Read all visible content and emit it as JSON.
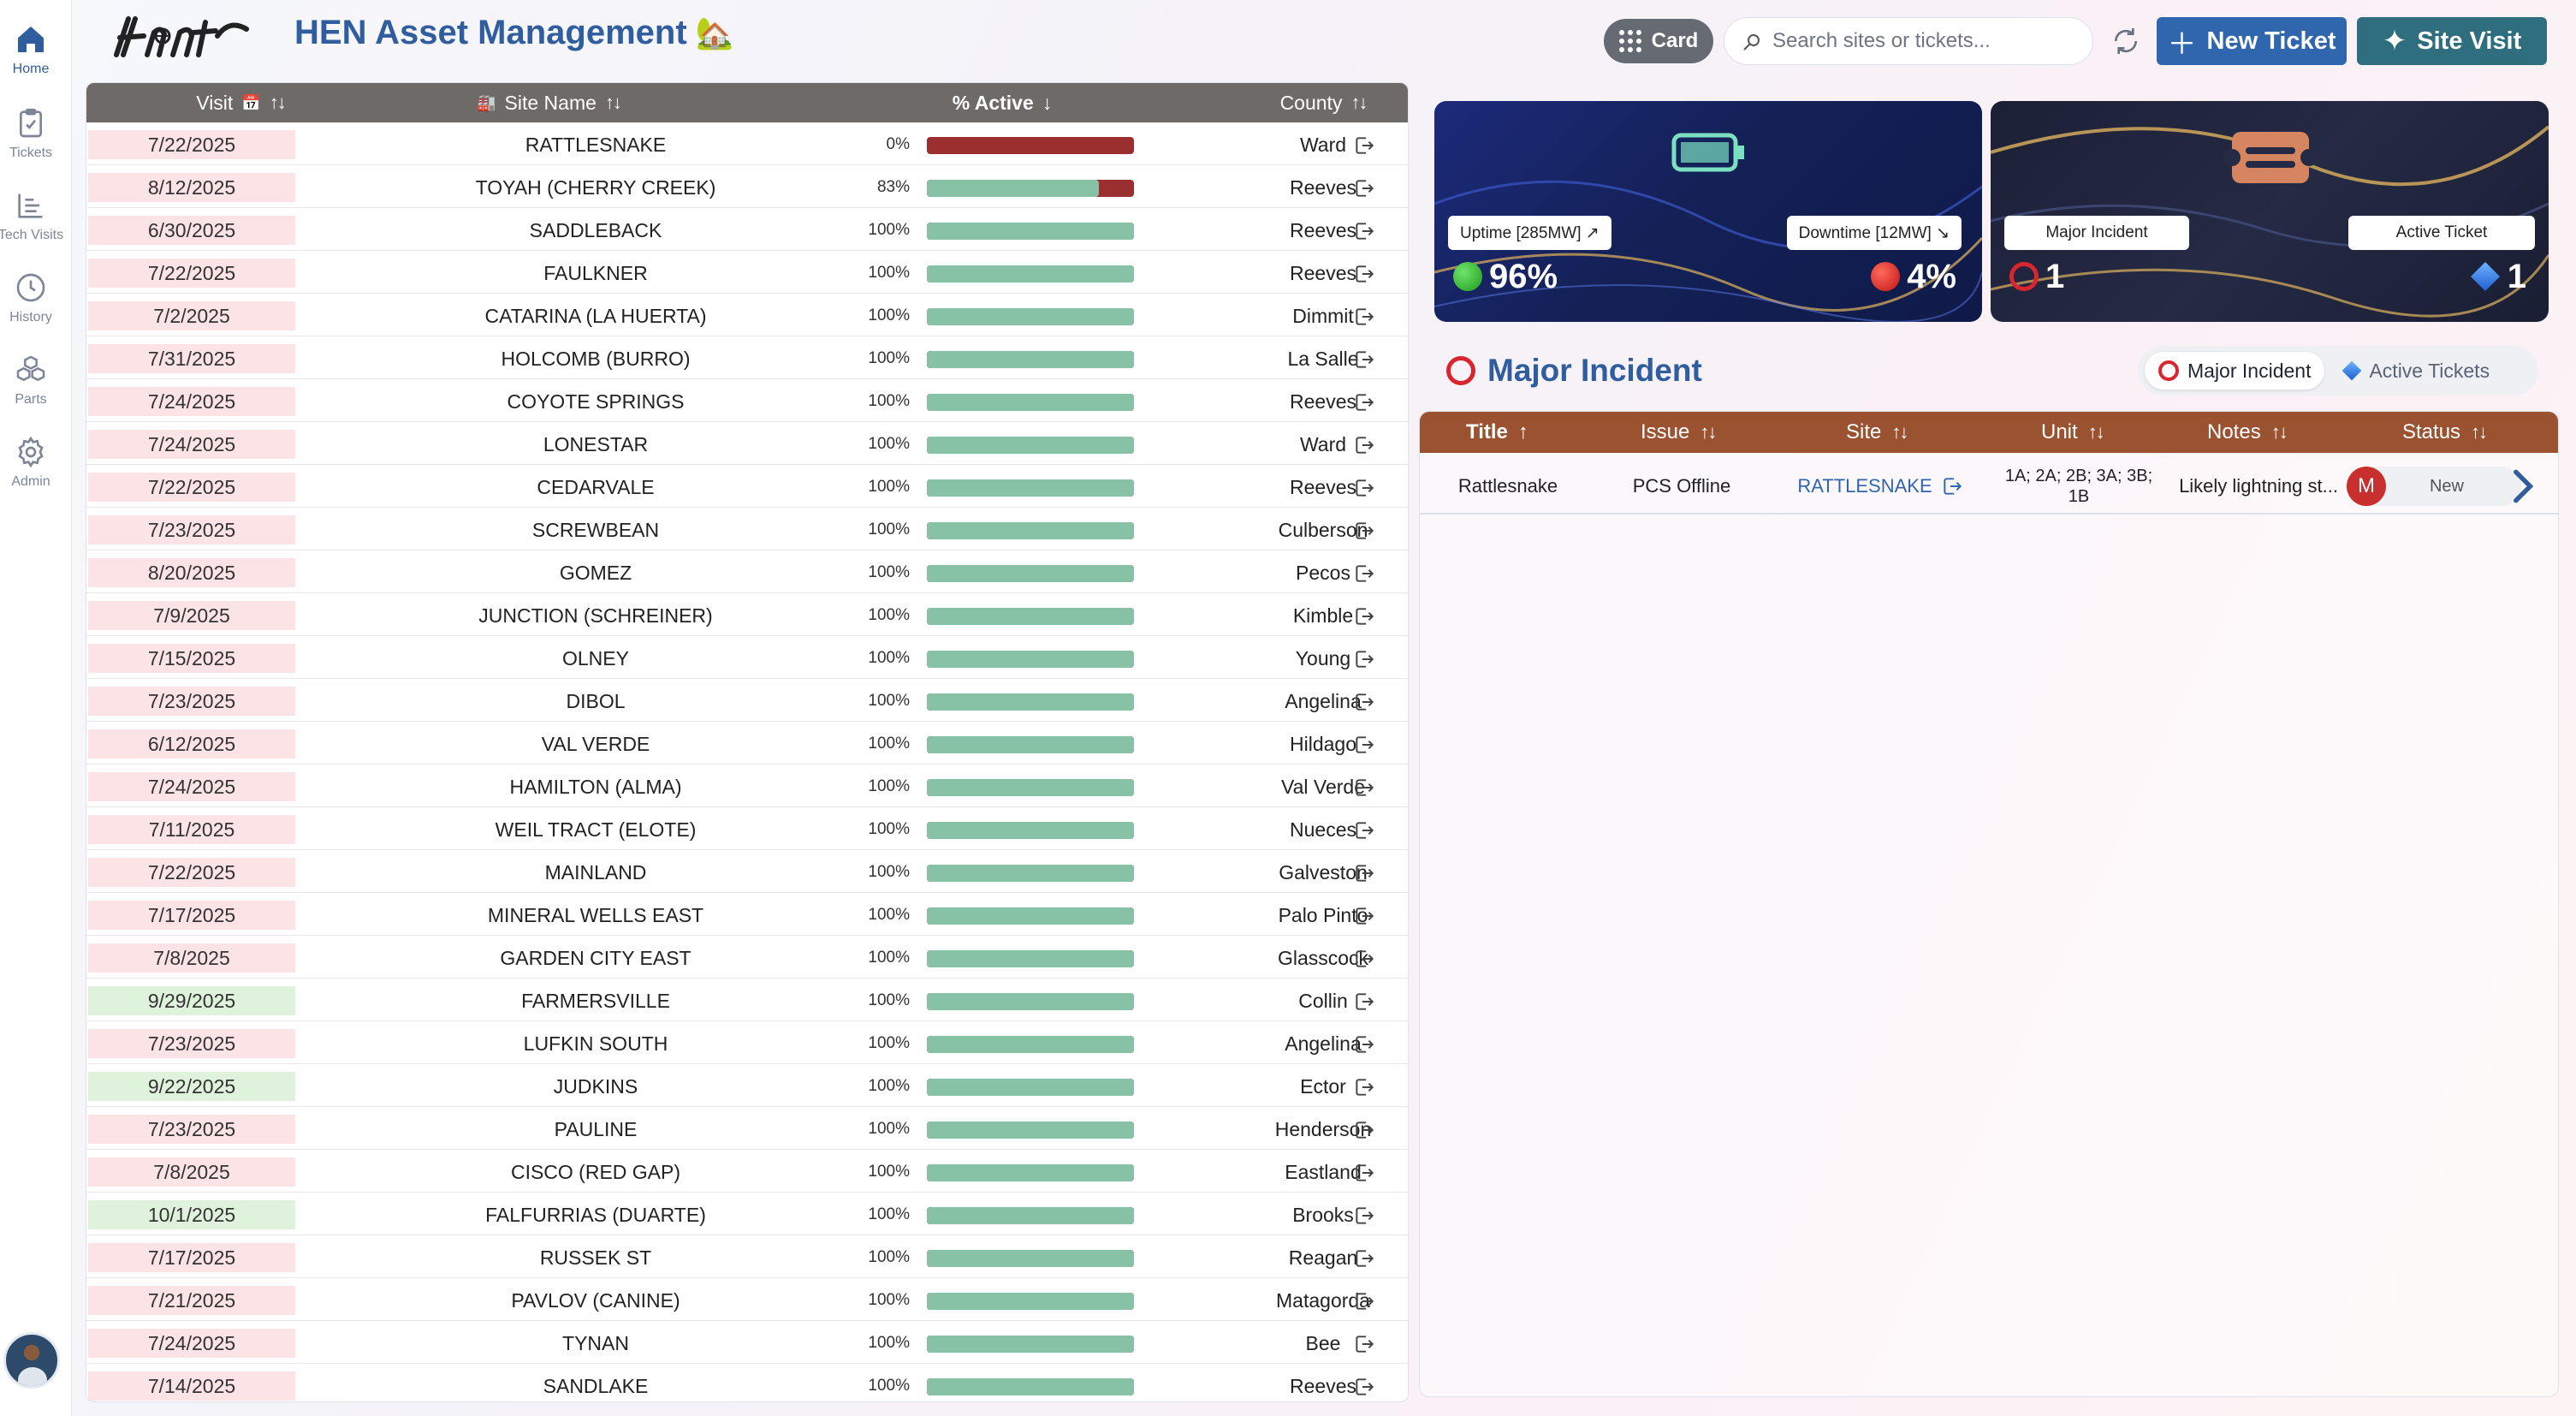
{
  "header": {
    "app_title": "HEN Asset Management",
    "title_emoji": "🏡",
    "view_toggle_label": "Card",
    "search_placeholder": "Search sites or tickets...",
    "new_ticket_label": "New Ticket",
    "site_visit_label": "Site Visit"
  },
  "sidebar": {
    "items": [
      {
        "label": "Home",
        "icon": "home-icon",
        "active": true
      },
      {
        "label": "Tickets",
        "icon": "clipboard-icon",
        "active": false
      },
      {
        "label": "Tech Visits",
        "icon": "list-icon",
        "active": false
      },
      {
        "label": "History",
        "icon": "clock-icon",
        "active": false
      },
      {
        "label": "Parts",
        "icon": "cubes-icon",
        "active": false
      },
      {
        "label": "Admin",
        "icon": "gear-icon",
        "active": false
      }
    ]
  },
  "site_table": {
    "columns": {
      "visit": "Visit",
      "visit_emoji": "📅",
      "site_name": "Site Name",
      "site_emoji": "🏭",
      "active": "% Active",
      "county": "County"
    },
    "rows": [
      {
        "visit": "7/22/2025",
        "visit_status": "red",
        "site": "RATTLESNAKE",
        "pct_label": "0%",
        "pct": 0,
        "county": "Ward"
      },
      {
        "visit": "8/12/2025",
        "visit_status": "red",
        "site": "TOYAH (CHERRY CREEK)",
        "pct_label": "83%",
        "pct": 83,
        "county": "Reeves"
      },
      {
        "visit": "6/30/2025",
        "visit_status": "red",
        "site": "SADDLEBACK",
        "pct_label": "100%",
        "pct": 100,
        "county": "Reeves"
      },
      {
        "visit": "7/22/2025",
        "visit_status": "red",
        "site": "FAULKNER",
        "pct_label": "100%",
        "pct": 100,
        "county": "Reeves"
      },
      {
        "visit": "7/2/2025",
        "visit_status": "red",
        "site": "CATARINA (LA HUERTA)",
        "pct_label": "100%",
        "pct": 100,
        "county": "Dimmit"
      },
      {
        "visit": "7/31/2025",
        "visit_status": "red",
        "site": "HOLCOMB (BURRO)",
        "pct_label": "100%",
        "pct": 100,
        "county": "La Salle"
      },
      {
        "visit": "7/24/2025",
        "visit_status": "red",
        "site": "COYOTE SPRINGS",
        "pct_label": "100%",
        "pct": 100,
        "county": "Reeves"
      },
      {
        "visit": "7/24/2025",
        "visit_status": "red",
        "site": "LONESTAR",
        "pct_label": "100%",
        "pct": 100,
        "county": "Ward"
      },
      {
        "visit": "7/22/2025",
        "visit_status": "red",
        "site": "CEDARVALE",
        "pct_label": "100%",
        "pct": 100,
        "county": "Reeves"
      },
      {
        "visit": "7/23/2025",
        "visit_status": "red",
        "site": "SCREWBEAN",
        "pct_label": "100%",
        "pct": 100,
        "county": "Culberson"
      },
      {
        "visit": "8/20/2025",
        "visit_status": "red",
        "site": "GOMEZ",
        "pct_label": "100%",
        "pct": 100,
        "county": "Pecos"
      },
      {
        "visit": "7/9/2025",
        "visit_status": "red",
        "site": "JUNCTION (SCHREINER)",
        "pct_label": "100%",
        "pct": 100,
        "county": "Kimble"
      },
      {
        "visit": "7/15/2025",
        "visit_status": "red",
        "site": "OLNEY",
        "pct_label": "100%",
        "pct": 100,
        "county": "Young"
      },
      {
        "visit": "7/23/2025",
        "visit_status": "red",
        "site": "DIBOL",
        "pct_label": "100%",
        "pct": 100,
        "county": "Angelina"
      },
      {
        "visit": "6/12/2025",
        "visit_status": "red",
        "site": "VAL VERDE",
        "pct_label": "100%",
        "pct": 100,
        "county": "Hildago"
      },
      {
        "visit": "7/24/2025",
        "visit_status": "red",
        "site": "HAMILTON (ALMA)",
        "pct_label": "100%",
        "pct": 100,
        "county": "Val Verde"
      },
      {
        "visit": "7/11/2025",
        "visit_status": "red",
        "site": "WEIL TRACT (ELOTE)",
        "pct_label": "100%",
        "pct": 100,
        "county": "Nueces"
      },
      {
        "visit": "7/22/2025",
        "visit_status": "red",
        "site": "MAINLAND",
        "pct_label": "100%",
        "pct": 100,
        "county": "Galveston"
      },
      {
        "visit": "7/17/2025",
        "visit_status": "red",
        "site": "MINERAL WELLS EAST",
        "pct_label": "100%",
        "pct": 100,
        "county": "Palo Pinto"
      },
      {
        "visit": "7/8/2025",
        "visit_status": "red",
        "site": "GARDEN CITY EAST",
        "pct_label": "100%",
        "pct": 100,
        "county": "Glasscock"
      },
      {
        "visit": "9/29/2025",
        "visit_status": "green",
        "site": "FARMERSVILLE",
        "pct_label": "100%",
        "pct": 100,
        "county": "Collin"
      },
      {
        "visit": "7/23/2025",
        "visit_status": "red",
        "site": "LUFKIN SOUTH",
        "pct_label": "100%",
        "pct": 100,
        "county": "Angelina"
      },
      {
        "visit": "9/22/2025",
        "visit_status": "green",
        "site": "JUDKINS",
        "pct_label": "100%",
        "pct": 100,
        "county": "Ector"
      },
      {
        "visit": "7/23/2025",
        "visit_status": "red",
        "site": "PAULINE",
        "pct_label": "100%",
        "pct": 100,
        "county": "Henderson"
      },
      {
        "visit": "7/8/2025",
        "visit_status": "red",
        "site": "CISCO (RED GAP)",
        "pct_label": "100%",
        "pct": 100,
        "county": "Eastland"
      },
      {
        "visit": "10/1/2025",
        "visit_status": "green",
        "site": "FALFURRIAS (DUARTE)",
        "pct_label": "100%",
        "pct": 100,
        "county": "Brooks"
      },
      {
        "visit": "7/17/2025",
        "visit_status": "red",
        "site": "RUSSEK ST",
        "pct_label": "100%",
        "pct": 100,
        "county": "Reagan"
      },
      {
        "visit": "7/21/2025",
        "visit_status": "red",
        "site": "PAVLOV (CANINE)",
        "pct_label": "100%",
        "pct": 100,
        "county": "Matagorda"
      },
      {
        "visit": "7/24/2025",
        "visit_status": "red",
        "site": "TYNAN",
        "pct_label": "100%",
        "pct": 100,
        "county": "Bee"
      },
      {
        "visit": "7/14/2025",
        "visit_status": "red",
        "site": "SANDLAKE",
        "pct_label": "100%",
        "pct": 100,
        "county": "Reeves"
      }
    ]
  },
  "stats": {
    "uptime_label": "Uptime [285MW] ↗",
    "uptime_value": "96%",
    "downtime_label": "Downtime [12MW] ↘",
    "downtime_value": "4%",
    "major_incident_label": "Major Incident",
    "major_incident_value": "1",
    "active_ticket_label": "Active Ticket",
    "active_ticket_value": "1"
  },
  "incidents": {
    "section_title": "Major Incident",
    "tabs": [
      {
        "label": "Major Incident",
        "active": true
      },
      {
        "label": "Active Tickets",
        "active": false
      }
    ],
    "columns": {
      "title": "Title",
      "issue": "Issue",
      "site": "Site",
      "unit": "Unit",
      "notes": "Notes",
      "status": "Status"
    },
    "rows": [
      {
        "title": "Rattlesnake",
        "issue": "PCS Offline",
        "site": "RATTLESNAKE",
        "unit": "1A; 2A; 2B; 3A; 3B; 1B",
        "notes": "Likely lightning st...",
        "assignee_initial": "M",
        "status": "New"
      }
    ]
  },
  "colors": {
    "brand_blue": "#2f5d9e",
    "visit_overdue": "#fbe3e6",
    "visit_ok": "#dff3dc",
    "active_bar": "#87c1a6",
    "inactive_bar": "#9b2e2e",
    "incident_header": "#9b5231"
  }
}
